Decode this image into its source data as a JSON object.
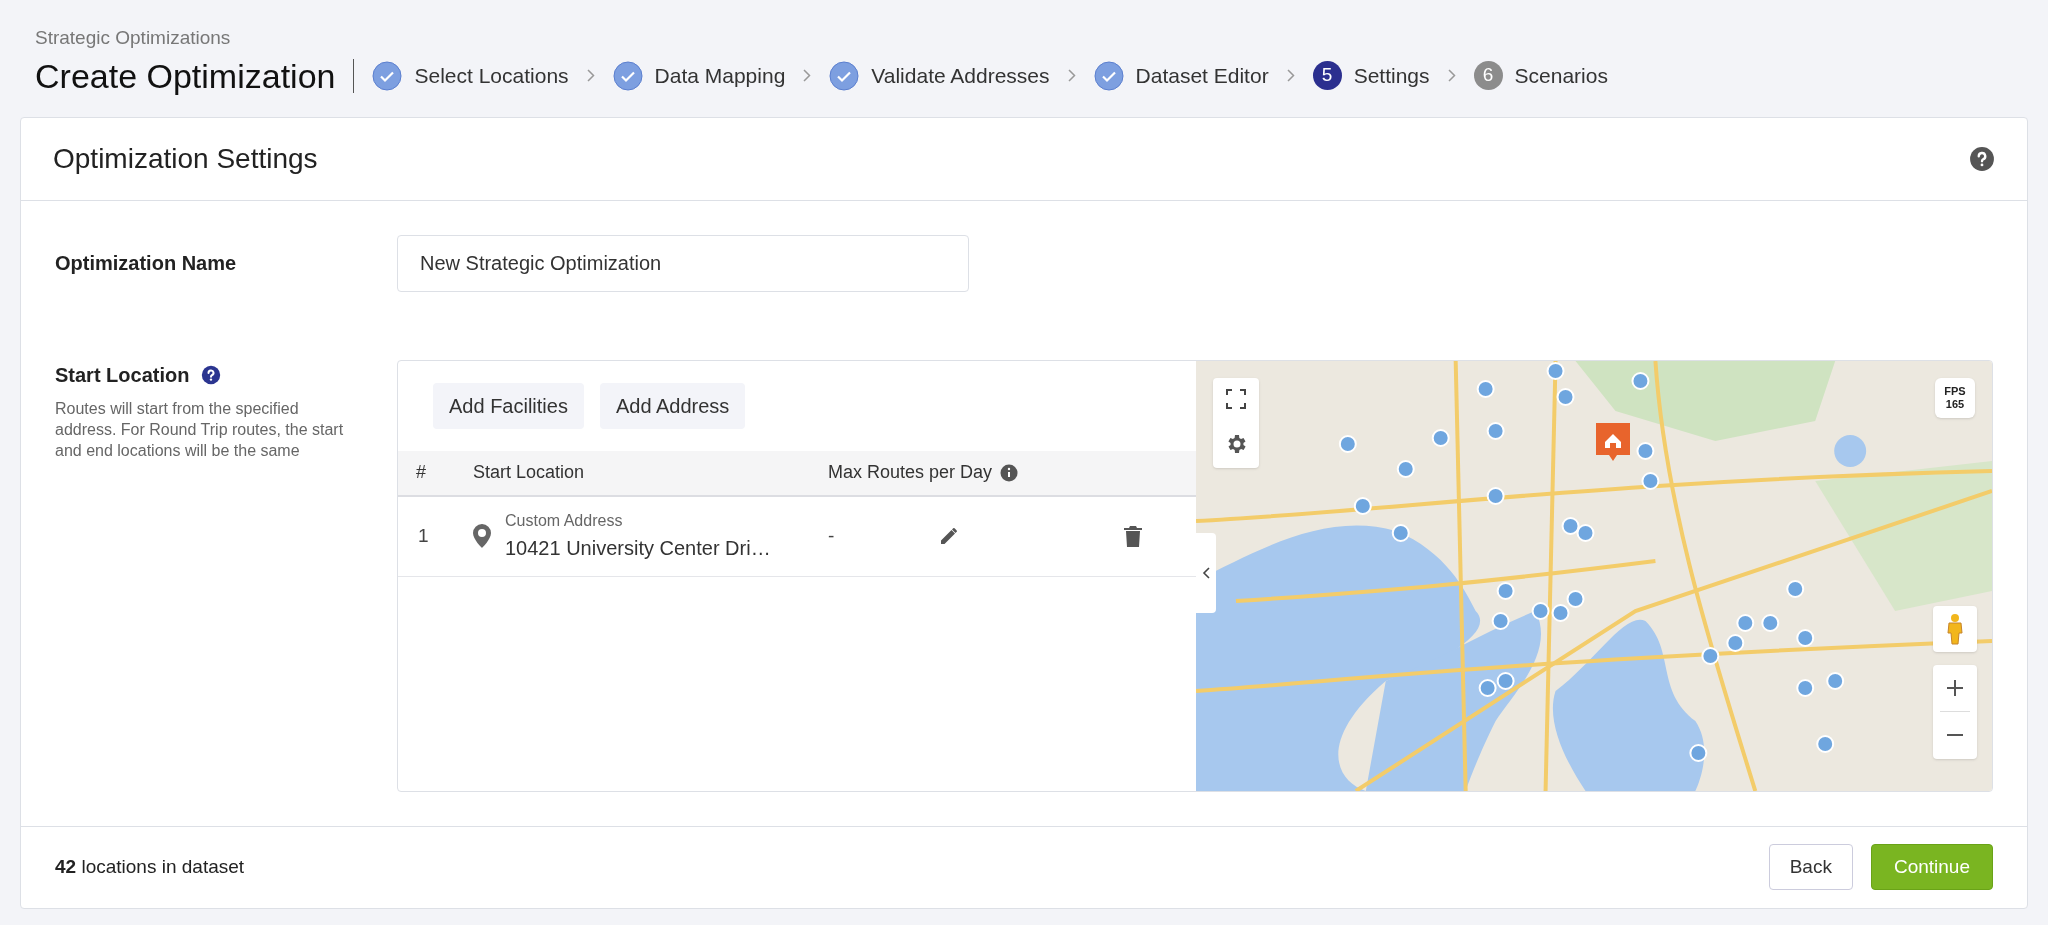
{
  "breadcrumb": "Strategic Optimizations",
  "page_title": "Create Optimization",
  "steps": [
    {
      "label": "Select Locations",
      "completed": true,
      "selected": false
    },
    {
      "label": "Data Mapping",
      "completed": true,
      "selected": false
    },
    {
      "label": "Validate Addresses",
      "completed": true,
      "selected": false
    },
    {
      "label": "Dataset Editor",
      "completed": true,
      "selected": false
    },
    {
      "label": "Settings",
      "number": "5",
      "completed": false,
      "selected": true
    },
    {
      "label": "Scenarios",
      "number": "6",
      "completed": false,
      "selected": false
    }
  ],
  "card_title": "Optimization Settings",
  "name_field": {
    "label": "Optimization Name",
    "value": "New Strategic Optimization"
  },
  "start_location": {
    "label": "Start Location",
    "help": "Routes will start from the specified address. For Round Trip routes, the start and end locations will be the same",
    "buttons": [
      "Add Facilities",
      "Add Address"
    ],
    "columns": [
      "#",
      "Start Location",
      "Max Routes per Day"
    ],
    "rows": [
      {
        "index": "1",
        "type": "Custom Address",
        "address": "10421 University Center Dri…",
        "max_routes": "-"
      }
    ]
  },
  "map": {
    "fps_label": "FPS",
    "fps_value": "165"
  },
  "footer": {
    "summary": "**42** locations in dataset",
    "buttons": [
      {
        "label": "Back",
        "kind": "secondary"
      },
      {
        "label": "Continue",
        "kind": "primary"
      }
    ]
  }
}
